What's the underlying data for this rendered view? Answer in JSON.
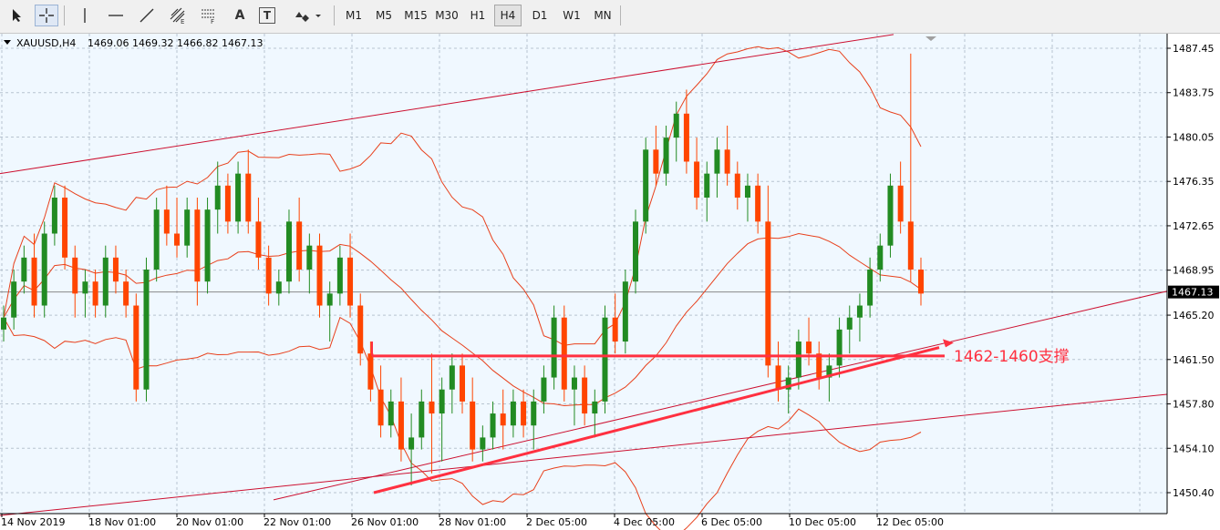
{
  "toolbar": {
    "tools": [
      {
        "name": "cursor-icon"
      },
      {
        "name": "crosshair-icon"
      },
      {
        "name": "vertical-line-icon"
      },
      {
        "name": "horizontal-line-icon"
      },
      {
        "name": "trendline-icon"
      },
      {
        "name": "equidistant-channel-icon"
      },
      {
        "name": "fibonacci-icon"
      },
      {
        "name": "text-icon",
        "label": "A"
      },
      {
        "name": "text-label-icon",
        "label": "T"
      },
      {
        "name": "shapes-icon"
      }
    ],
    "timeframes": [
      "M1",
      "M5",
      "M15",
      "M30",
      "H1",
      "H4",
      "D1",
      "W1",
      "MN"
    ],
    "active_timeframe": "H4"
  },
  "chart_header": {
    "symbol": "XAUUSD,H4",
    "ohlc": "1469.06 1469.32 1466.82 1467.13"
  },
  "annotation": {
    "text": "1462-1460支撑"
  },
  "colors": {
    "background": "#f0f8ff",
    "up_candle": "#228b22",
    "down_candle": "#ff4500",
    "indicator": "#e8401c",
    "annotation": "#ff3040",
    "channel": "#cc1030"
  },
  "chart_data": {
    "type": "candlestick",
    "symbol": "XAUUSD",
    "timeframe": "H4",
    "last_price": 1467.13,
    "price_labels": [
      "1487.45",
      "1483.75",
      "1480.05",
      "1476.35",
      "1472.65",
      "1468.95",
      "1465.20",
      "1461.50",
      "1457.80",
      "1454.10",
      "1450.40"
    ],
    "date_labels": [
      "14 Nov 2019",
      "18 Nov 01:00",
      "20 Nov 01:00",
      "22 Nov 01:00",
      "26 Nov 01:00",
      "28 Nov 01:00",
      "2 Dec 05:00",
      "4 Dec 05:00",
      "6 Dec 05:00",
      "10 Dec 05:00",
      "12 Dec 05:00"
    ],
    "support_level": 1461.8,
    "candles": [
      [
        1464,
        1466,
        1463,
        1465
      ],
      [
        1465,
        1469,
        1464,
        1468
      ],
      [
        1468,
        1471,
        1467,
        1470
      ],
      [
        1470,
        1472,
        1465,
        1466
      ],
      [
        1466,
        1473,
        1465,
        1472
      ],
      [
        1472,
        1476,
        1471,
        1475
      ],
      [
        1475,
        1476,
        1469,
        1470
      ],
      [
        1470,
        1471,
        1465,
        1467
      ],
      [
        1467,
        1469,
        1465,
        1468
      ],
      [
        1468,
        1469,
        1465,
        1466
      ],
      [
        1466,
        1471,
        1465,
        1470
      ],
      [
        1470,
        1471,
        1467,
        1468
      ],
      [
        1468,
        1469,
        1465,
        1466
      ],
      [
        1466,
        1467,
        1458,
        1459
      ],
      [
        1459,
        1470,
        1458,
        1469
      ],
      [
        1469,
        1475,
        1468,
        1474
      ],
      [
        1474,
        1476,
        1471,
        1472
      ],
      [
        1472,
        1475,
        1470,
        1471
      ],
      [
        1471,
        1475,
        1470,
        1474
      ],
      [
        1474,
        1475,
        1466,
        1468
      ],
      [
        1468,
        1475,
        1467,
        1474
      ],
      [
        1474,
        1478,
        1472,
        1476
      ],
      [
        1476,
        1477,
        1472,
        1473
      ],
      [
        1473,
        1478,
        1472,
        1477
      ],
      [
        1477,
        1479,
        1472,
        1473
      ],
      [
        1473,
        1475,
        1469,
        1470
      ],
      [
        1470,
        1471,
        1466,
        1467
      ],
      [
        1467,
        1469,
        1466,
        1468
      ],
      [
        1468,
        1474,
        1467,
        1473
      ],
      [
        1473,
        1475,
        1468,
        1469
      ],
      [
        1469,
        1472,
        1467,
        1471
      ],
      [
        1471,
        1472,
        1465,
        1466
      ],
      [
        1466,
        1468,
        1463,
        1467
      ],
      [
        1467,
        1471,
        1466,
        1470
      ],
      [
        1470,
        1472,
        1465,
        1466
      ],
      [
        1466,
        1467,
        1461,
        1462
      ],
      [
        1462,
        1463,
        1458,
        1459
      ],
      [
        1459,
        1461,
        1455,
        1456
      ],
      [
        1456,
        1459,
        1455,
        1458
      ],
      [
        1458,
        1460,
        1453,
        1454
      ],
      [
        1454,
        1457,
        1451,
        1455
      ],
      [
        1455,
        1459,
        1454,
        1458
      ],
      [
        1458,
        1462,
        1452,
        1457
      ],
      [
        1457,
        1460,
        1453,
        1459
      ],
      [
        1459,
        1462,
        1457,
        1461
      ],
      [
        1461,
        1462,
        1457,
        1458
      ],
      [
        1458,
        1460,
        1453,
        1454
      ],
      [
        1454,
        1456,
        1453,
        1455
      ],
      [
        1455,
        1458,
        1454,
        1457
      ],
      [
        1457,
        1459,
        1454,
        1456
      ],
      [
        1456,
        1459,
        1455,
        1458
      ],
      [
        1458,
        1459,
        1455,
        1456
      ],
      [
        1456,
        1459,
        1454,
        1458
      ],
      [
        1458,
        1461,
        1457,
        1460
      ],
      [
        1460,
        1466,
        1459,
        1465
      ],
      [
        1465,
        1466,
        1458,
        1459
      ],
      [
        1459,
        1461,
        1456,
        1460
      ],
      [
        1460,
        1461,
        1456,
        1457
      ],
      [
        1457,
        1459,
        1455,
        1458
      ],
      [
        1458,
        1466,
        1457,
        1465
      ],
      [
        1465,
        1467,
        1462,
        1463
      ],
      [
        1463,
        1469,
        1462,
        1468
      ],
      [
        1468,
        1474,
        1467,
        1473
      ],
      [
        1473,
        1480,
        1472,
        1479
      ],
      [
        1479,
        1481,
        1476,
        1477
      ],
      [
        1477,
        1481,
        1476,
        1480
      ],
      [
        1480,
        1483,
        1478,
        1482
      ],
      [
        1482,
        1484,
        1477,
        1478
      ],
      [
        1478,
        1480,
        1474,
        1475
      ],
      [
        1475,
        1478,
        1473,
        1477
      ],
      [
        1477,
        1480,
        1475,
        1479
      ],
      [
        1479,
        1481,
        1476,
        1477
      ],
      [
        1477,
        1478,
        1474,
        1475
      ],
      [
        1475,
        1477,
        1473,
        1476
      ],
      [
        1476,
        1477,
        1472,
        1473
      ],
      [
        1473,
        1476,
        1460,
        1461
      ],
      [
        1461,
        1463,
        1458,
        1459
      ],
      [
        1459,
        1461,
        1457,
        1460
      ],
      [
        1460,
        1464,
        1459,
        1463
      ],
      [
        1463,
        1465,
        1461,
        1462
      ],
      [
        1462,
        1463,
        1459,
        1460
      ],
      [
        1460,
        1462,
        1458,
        1461
      ],
      [
        1461,
        1465,
        1460,
        1464
      ],
      [
        1464,
        1466,
        1462,
        1465
      ],
      [
        1465,
        1467,
        1463,
        1466
      ],
      [
        1466,
        1470,
        1465,
        1469
      ],
      [
        1469,
        1472,
        1468,
        1471
      ],
      [
        1471,
        1477,
        1470,
        1476
      ],
      [
        1476,
        1478,
        1472,
        1473
      ],
      [
        1473,
        1487,
        1468,
        1469
      ],
      [
        1469,
        1470,
        1466,
        1467
      ]
    ]
  }
}
